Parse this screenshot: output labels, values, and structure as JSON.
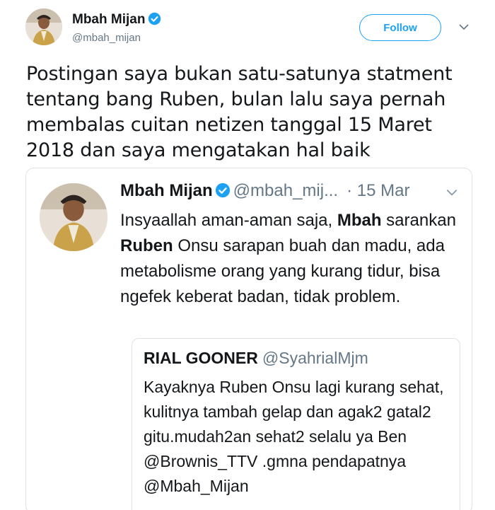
{
  "author": {
    "name": "Mbah Mijan",
    "handle": "@mbah_mijan",
    "verified_icon": "verified-badge-icon",
    "avatar_icon": "profile-photo"
  },
  "actions": {
    "follow_label": "Follow",
    "more_icon": "chevron-down-icon"
  },
  "tweet": {
    "text": "Postingan saya bukan satu-satunya statment tentang bang Ruben, bulan lalu saya pernah membalas cuitan netizen tanggal 15 Maret 2018 dan saya mengatakan hal baik"
  },
  "quoted": {
    "name": "Mbah Mijan",
    "handle": "@mbah_mij...",
    "date": "· 15 Mar",
    "text_parts": [
      {
        "t": "Insyaallah aman-aman saja, ",
        "b": false
      },
      {
        "t": "Mbah",
        "b": true
      },
      {
        "t": " sarankan ",
        "b": false
      },
      {
        "t": "Ruben",
        "b": true
      },
      {
        "t": " Onsu sarapan buah dan madu, ada metabolisme orang yang kurang tidur, bisa ngefek keberat badan, tidak problem.",
        "b": false
      }
    ],
    "nested": {
      "name": "RIAL GOONER",
      "handle": "@SyahrialMjm",
      "text": "Kayaknya Ruben Onsu lagi kurang sehat, kulitnya tambah gelap dan agak2 gatal2 gitu.mudah2an sehat2 selalu ya Ben @Brownis_TTV .gmna pendapatnya @Mbah_Mijan"
    }
  },
  "colors": {
    "accent": "#1da1f2",
    "text": "#14171a",
    "secondary": "#657786",
    "border": "#dfe3e7"
  }
}
